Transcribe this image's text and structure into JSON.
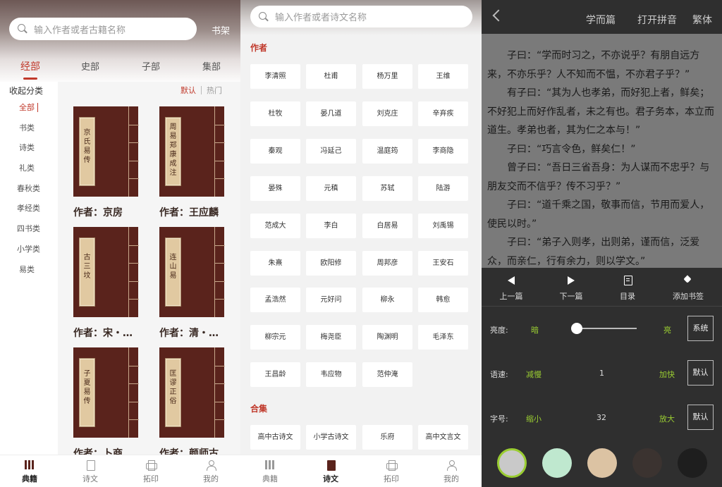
{
  "panel1": {
    "search_placeholder": "输入作者或者古籍名称",
    "shelf_label": "书架",
    "tabs": [
      "经部",
      "史部",
      "子部",
      "集部"
    ],
    "collapse_label": "收起分类",
    "sort": {
      "default": "默认",
      "hot": "热门"
    },
    "categories": [
      "全部",
      "书类",
      "诗类",
      "礼类",
      "春秋类",
      "孝经类",
      "四书类",
      "小学类",
      "易类"
    ],
    "books": [
      {
        "title": "京氏易传",
        "author": "作者：京房"
      },
      {
        "title": "周易郑康成注",
        "author": "作者：王应麟"
      },
      {
        "title": "古三坟",
        "author": "作者：宋・…"
      },
      {
        "title": "连山易",
        "author": "作者：清・…"
      },
      {
        "title": "子夏易传",
        "author": "作者：卜商"
      },
      {
        "title": "匡谬正俗",
        "author": "作者：颜师古"
      }
    ],
    "tabbar": [
      "典籍",
      "诗文",
      "拓印",
      "我的"
    ]
  },
  "panel2": {
    "search_placeholder": "输入作者或者诗文名称",
    "section_authors": "作者",
    "authors": [
      "李清照",
      "杜甫",
      "杨万里",
      "王维",
      "杜牧",
      "晏几道",
      "刘克庄",
      "辛弃疾",
      "秦观",
      "冯延己",
      "温庭筠",
      "李商隐",
      "晏殊",
      "元稹",
      "苏轼",
      "陆游",
      "范成大",
      "李白",
      "白居易",
      "刘禹锡",
      "朱熹",
      "欧阳修",
      "周邦彦",
      "王安石",
      "孟浩然",
      "元好问",
      "柳永",
      "韩愈",
      "柳宗元",
      "梅尧臣",
      "陶渊明",
      "毛泽东",
      "王昌龄",
      "韦应物",
      "范仲淹"
    ],
    "section_collections": "合集",
    "collections": [
      "高中古诗文",
      "小学古诗文",
      "乐府",
      "高中文言文"
    ],
    "tabbar": [
      "典籍",
      "诗文",
      "拓印",
      "我的"
    ]
  },
  "panel3": {
    "top_links": [
      "学而篇",
      "打开拼音",
      "繁体"
    ],
    "paragraphs": [
      "子曰：“学而时习之，不亦说乎？有朋自远方来，不亦乐乎？人不知而不愠，不亦君子乎？”",
      "有子曰：“其为人也孝弟，而好犯上者，鲜矣；不好犯上而好作乱者，未之有也。君子务本，本立而道生。孝弟也者，其为仁之本与！”",
      "子曰：“巧言令色，鲜矣仁！”",
      "曾子曰：“吾日三省吾身：为人谋而不忠乎？与朋友交而不信乎？传不习乎？”",
      "子曰：“道千乘之国，敬事而信，节用而爱人，使民以时。”",
      "子曰：“弟子入则孝，出则弟，谨而信，泛爱众，而亲仁，行有余力，则以学文。”"
    ],
    "nav": [
      "上一篇",
      "下一篇",
      "目录",
      "添加书签"
    ],
    "brightness": {
      "label": "亮度:",
      "low": "暗",
      "high": "亮",
      "button": "系统",
      "level": 0.05
    },
    "speed": {
      "label": "语速:",
      "dec": "减慢",
      "value": "1",
      "inc": "加快",
      "button": "默认"
    },
    "font": {
      "label": "字号:",
      "dec": "缩小",
      "value": "32",
      "inc": "放大",
      "button": "默认"
    },
    "themes": [
      "#c9c9c9",
      "#bfe8cf",
      "#dcc3a3",
      "#3b3330",
      "#1e1e1e"
    ]
  }
}
